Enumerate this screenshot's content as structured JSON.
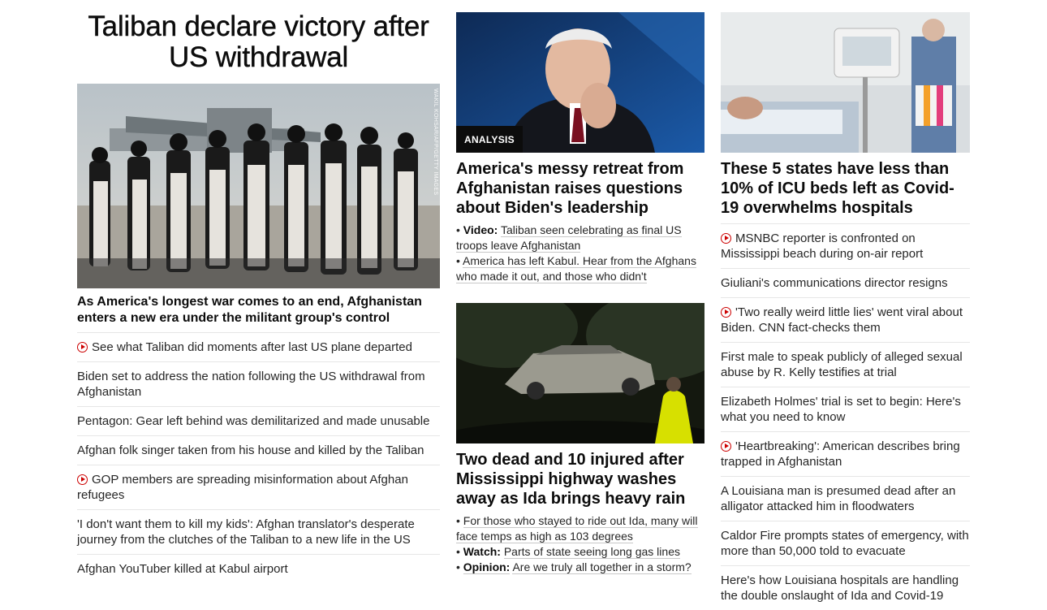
{
  "lead": {
    "headline": "Taliban declare victory after US withdrawal",
    "photo_credit": "WAKIL KOHSAR/AFP/GETTY IMAGES",
    "caption": "As America's longest war comes to an end, Afghanistan enters a new era under the militant group's control",
    "stories": [
      {
        "text": "See what Taliban did moments after last US plane departed",
        "video": true
      },
      {
        "text": "Biden set to address the nation following the US withdrawal from Afghanistan",
        "video": false
      },
      {
        "text": "Pentagon: Gear left behind was demilitarized and made unusable",
        "video": false
      },
      {
        "text": "Afghan folk singer taken from his house and killed by the Taliban",
        "video": false
      },
      {
        "text": "GOP members are spreading misinformation about Afghan refugees",
        "video": true
      },
      {
        "text": "'I don't want them to kill my kids': Afghan translator's desperate journey from the clutches of the Taliban to a new life in the US",
        "video": false
      },
      {
        "text": "Afghan YouTuber killed at Kabul airport",
        "video": false
      }
    ]
  },
  "card1": {
    "badge": "ANALYSIS",
    "title": "America's messy retreat from Afghanistan raises questions about Biden's leadership",
    "bullets": [
      {
        "prefix": "Video:",
        "text": "Taliban seen celebrating as final US troops leave Afghanistan"
      },
      {
        "prefix": "",
        "text": "America has left Kabul. Hear from the Afghans who made it out, and those who didn't"
      }
    ]
  },
  "card2": {
    "title": "Two dead and 10 injured after Mississippi highway washes away as Ida brings heavy rain",
    "bullets": [
      {
        "prefix": "",
        "text": "For those who stayed to ride out Ida, many will face temps as high as 103 degrees"
      },
      {
        "prefix": "Watch:",
        "text": "Parts of state seeing long gas lines"
      },
      {
        "prefix": "Opinion:",
        "text": "Are we truly all together in a storm?"
      }
    ]
  },
  "card3": {
    "title": "These 5 states have less than 10% of ICU beds left as Covid-19 overwhelms hospitals",
    "stories": [
      {
        "text": "MSNBC reporter is confronted on Mississippi beach during on-air report",
        "video": true
      },
      {
        "text": "Giuliani's communications director resigns",
        "video": false
      },
      {
        "text": "'Two really weird little lies' went viral about Biden. CNN fact-checks them",
        "video": true
      },
      {
        "text": "First male to speak publicly of alleged sexual abuse by R. Kelly testifies at trial",
        "video": false
      },
      {
        "text": "Elizabeth Holmes' trial is set to begin: Here's what you need to know",
        "video": false
      },
      {
        "text": "'Heartbreaking': American describes bring trapped in Afghanistan",
        "video": true
      },
      {
        "text": "A Louisiana man is presumed dead after an alligator attacked him in floodwaters",
        "video": false
      },
      {
        "text": "Caldor Fire prompts states of emergency, with more than 50,000 told to evacuate",
        "video": false
      },
      {
        "text": "Here's how Louisiana hospitals are handling the double onslaught of Ida and Covid-19",
        "video": false
      }
    ]
  },
  "colors": {
    "accent": "#cc0000",
    "text": "#262626",
    "divider": "#e6e6e6"
  }
}
